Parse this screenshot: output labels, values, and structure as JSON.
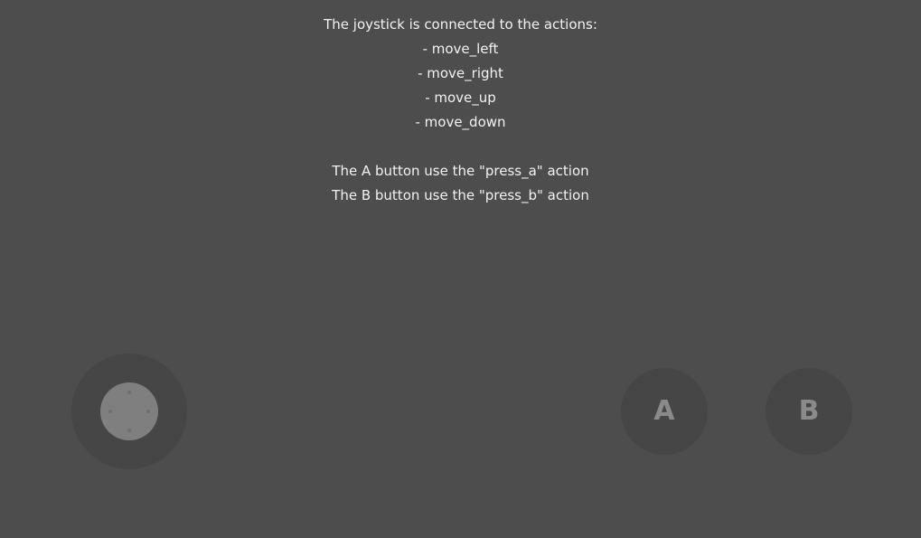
{
  "instructions": {
    "lines": [
      "The joystick is connected to the actions:",
      "- move_left",
      "- move_right",
      "- move_up",
      "- move_down",
      "",
      "The A button use the \"press_a\" action",
      "The B button use the \"press_b\" action"
    ]
  },
  "buttons": {
    "a_label": "A",
    "b_label": "B"
  },
  "colors": {
    "background": "#4d4d4d",
    "control_base": "#464646",
    "joystick_knob": "#7f7f7f",
    "button_label": "#8a8a8a",
    "text": "#f2f2f2"
  }
}
